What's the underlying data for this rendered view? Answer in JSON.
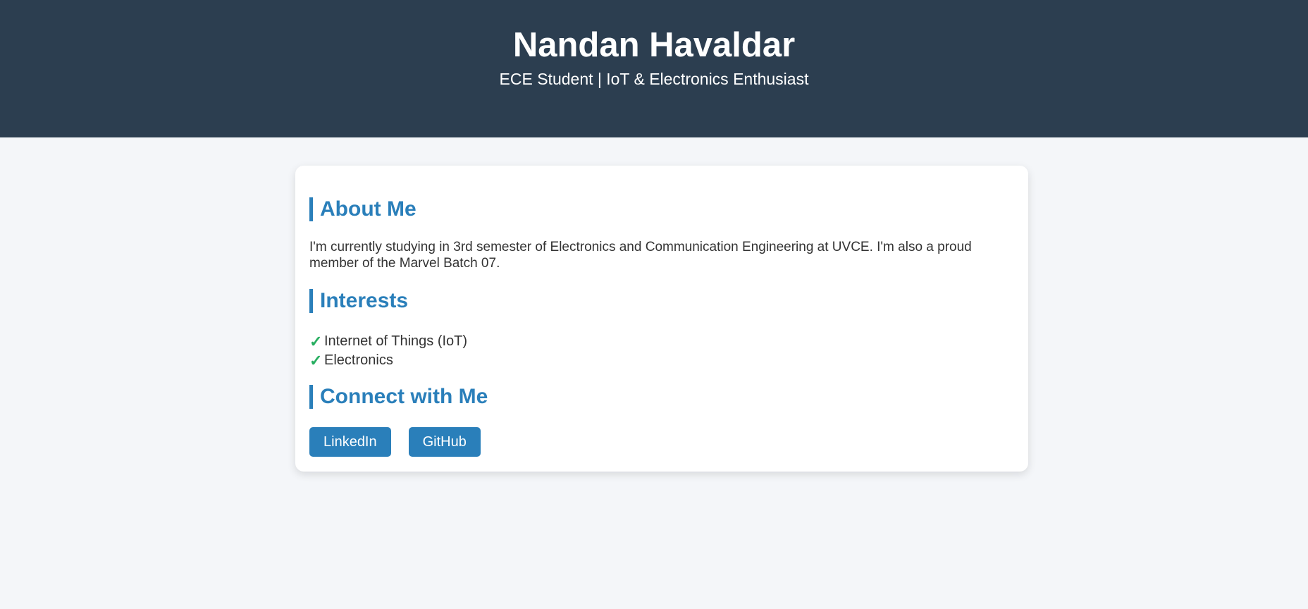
{
  "header": {
    "title": "Nandan Havaldar",
    "subtitle": "ECE Student | IoT & Electronics Enthusiast",
    "background_color": "#2c3e50"
  },
  "about": {
    "heading": "About Me",
    "text": "I'm currently studying in 3rd semester of Electronics and Communication Engineering at UVCE. I'm also a proud member of the Marvel Batch 07."
  },
  "interests": {
    "heading": "Interests",
    "check_icon": "check-icon",
    "check_glyph": "✓",
    "check_color": "#27ae60",
    "items": [
      {
        "label": "Internet of Things (IoT)"
      },
      {
        "label": "Electronics"
      }
    ]
  },
  "connect": {
    "heading": "Connect with Me",
    "buttons": [
      {
        "label": "LinkedIn"
      },
      {
        "label": "GitHub"
      }
    ]
  },
  "colors": {
    "accent": "#2a7fba",
    "page_background": "#f4f6f9",
    "card_background": "#ffffff"
  }
}
